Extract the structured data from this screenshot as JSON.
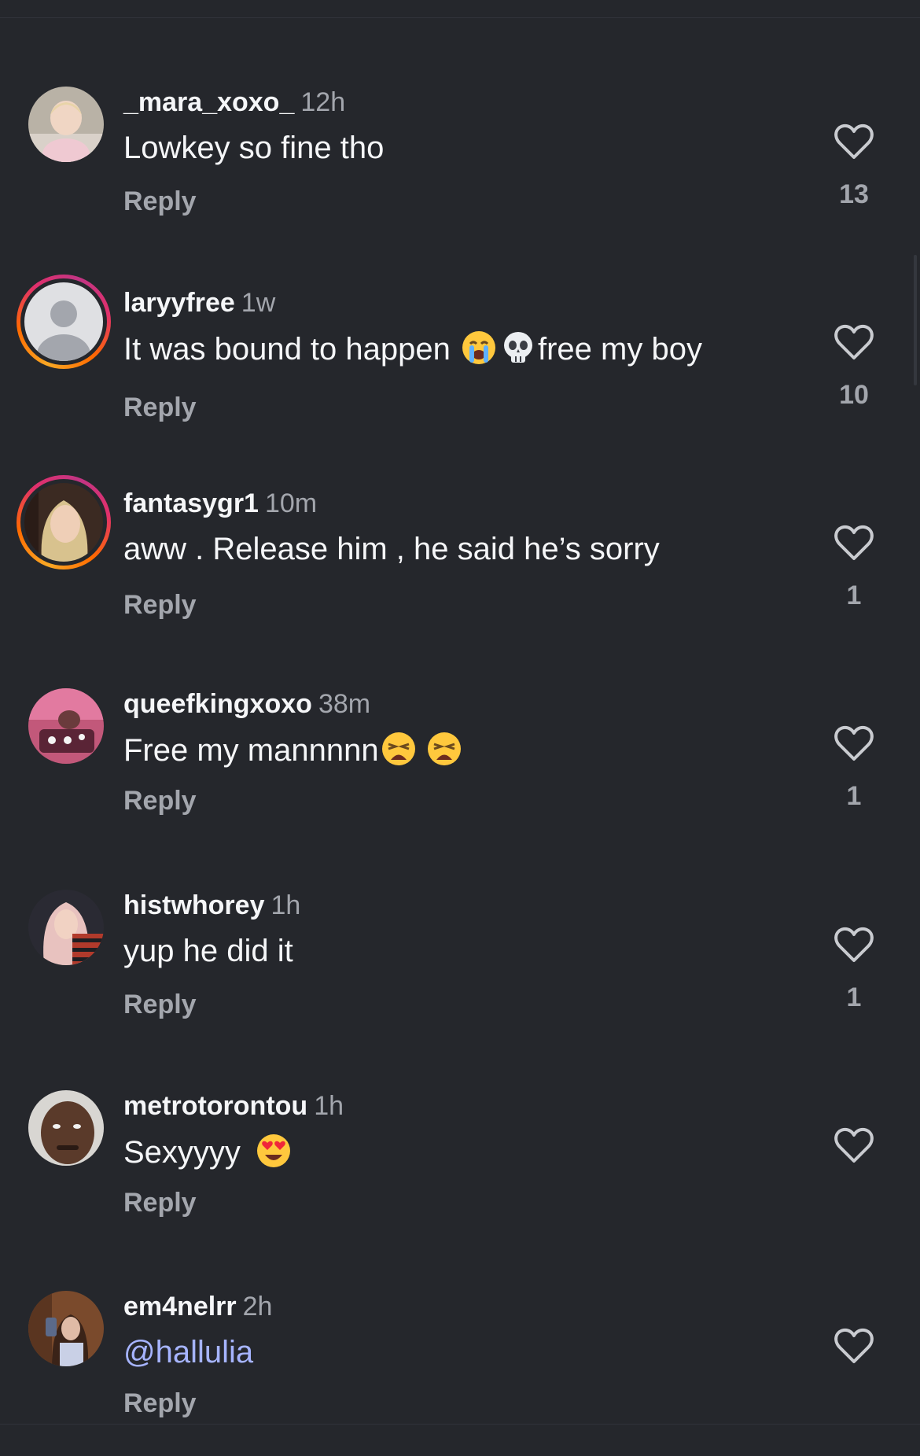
{
  "reply_label": "Reply",
  "colors": {
    "background": "#25272c",
    "username": "#f5f6f8",
    "secondary_text": "#a3a6ad",
    "mention": "#a6b4ff",
    "story_ring": [
      "#f9a825",
      "#ff6a00",
      "#e1306c",
      "#c13584"
    ]
  },
  "comments": [
    {
      "username": "_mara_xoxo_",
      "time": "12h",
      "text": "Lowkey so fine tho",
      "likes": "13",
      "has_story": false,
      "avatar": "child-photo"
    },
    {
      "username": "laryyfree",
      "time": "1w",
      "text_before": "It was bound to happen ",
      "emoji1": "crying-face-emoji",
      "emoji2": "skull-emoji",
      "text_after": "free my boy",
      "likes": "10",
      "has_story": true,
      "avatar": "default-avatar"
    },
    {
      "username": "fantasygr1",
      "time": "10m",
      "text": "aww . Release him , he said he’s sorry",
      "likes": "1",
      "has_story": true,
      "avatar": "blonde-woman-photo"
    },
    {
      "username": "queefkingxoxo",
      "time": "38m",
      "text": "Free my mannnnn",
      "emoji1": "weary-face-emoji",
      "emoji2": "weary-face-emoji",
      "likes": "1",
      "has_story": false,
      "avatar": "pink-room-photo"
    },
    {
      "username": "histwhorey",
      "time": "1h",
      "text": "yup he did it",
      "likes": "1",
      "has_story": false,
      "avatar": "woman-striped-shirt-photo"
    },
    {
      "username": "metrotorontou",
      "time": "1h",
      "text": "Sexyyyy ",
      "emoji1": "heart-eyes-emoji",
      "likes": "",
      "has_story": false,
      "avatar": "man-selfie-photo"
    },
    {
      "username": "em4nelrr",
      "time": "2h",
      "text": "@hallulia",
      "is_mention": true,
      "likes": "",
      "has_story": false,
      "avatar": "mirror-selfie-photo"
    }
  ]
}
